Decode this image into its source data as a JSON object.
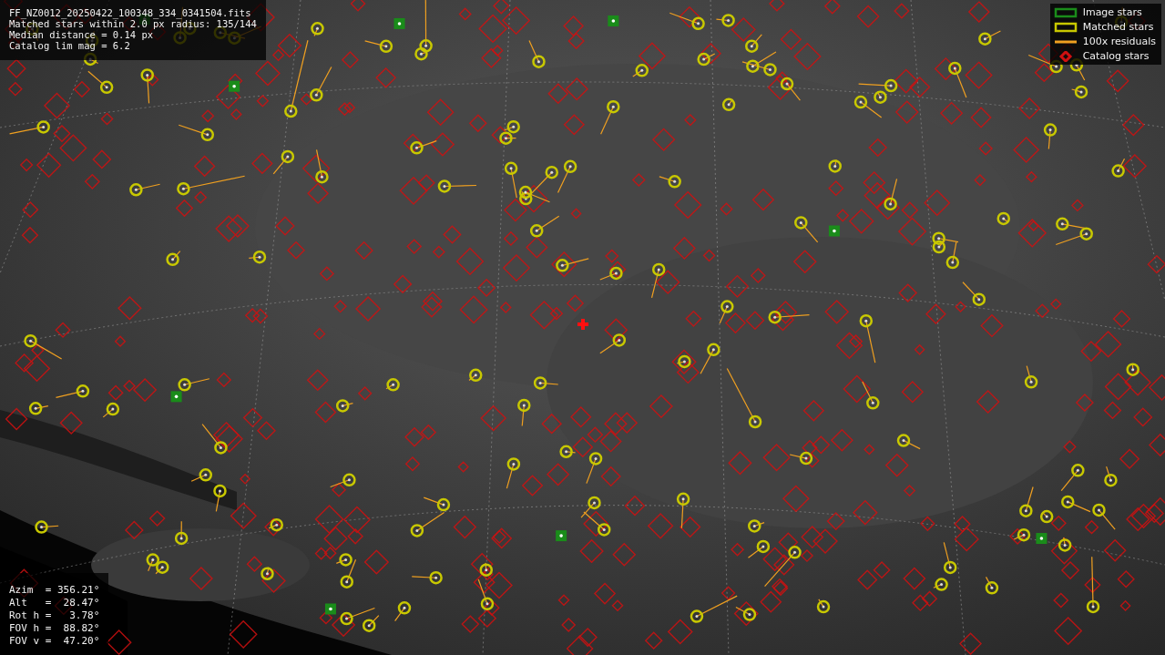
{
  "info": {
    "lines": [
      "FF_NZ0012_20250422_100348_334_0341504.fits",
      "Matched stars within 2.0 px radius: 135/144",
      "Median distance = 0.14 px",
      "Catalog lim mag = 6.2"
    ]
  },
  "legend": [
    {
      "kind": "box",
      "label": "Image stars",
      "color": "#1a8c1a"
    },
    {
      "kind": "box",
      "label": "Matched stars",
      "color": "#c8c800"
    },
    {
      "kind": "line",
      "label": "100x residuals",
      "color": "#f0a020"
    },
    {
      "kind": "diamond",
      "label": "Catalog stars",
      "color": "#d01010"
    }
  ],
  "pointing": {
    "lines": [
      "Azim  = 356.21°",
      "Alt   =  28.47°",
      "Rot h =   3.78°",
      "FOV h =  88.82°",
      "FOV v =  47.20°"
    ]
  }
}
